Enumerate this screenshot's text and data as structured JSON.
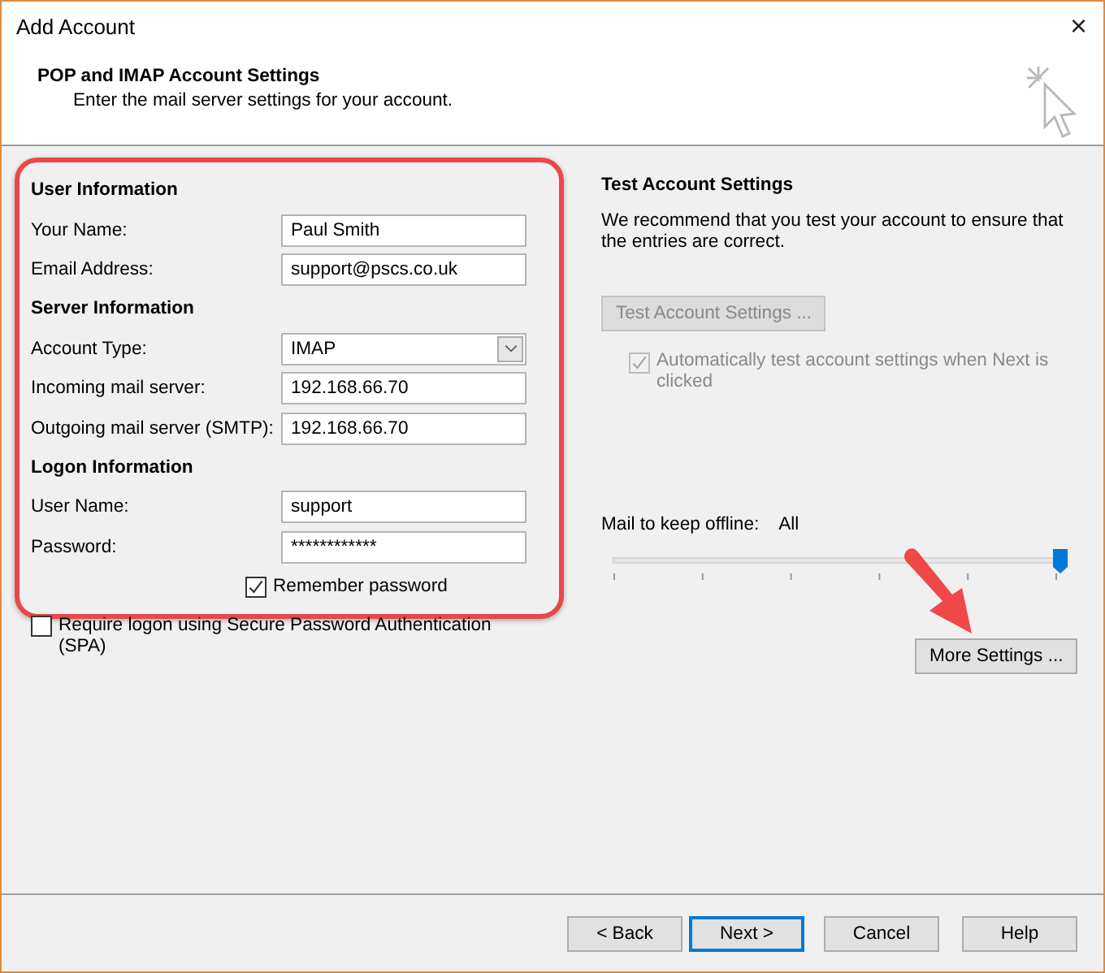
{
  "window": {
    "title": "Add Account",
    "close": "×"
  },
  "header": {
    "title": "POP and IMAP Account Settings",
    "subtitle": "Enter the mail server settings for your account."
  },
  "left": [
    {
      "kind": "heading",
      "label": "User Information"
    },
    {
      "kind": "text",
      "label": "Your Name:",
      "value": "Paul Smith"
    },
    {
      "kind": "text",
      "label": "Email Address:",
      "value": "support@pscs.co.uk"
    },
    {
      "kind": "heading",
      "label": "Server Information"
    },
    {
      "kind": "select",
      "label": "Account Type:",
      "value": "IMAP"
    },
    {
      "kind": "text",
      "label": "Incoming mail server:",
      "value": "192.168.66.70"
    },
    {
      "kind": "text",
      "label": "Outgoing mail server (SMTP):",
      "value": "192.168.66.70"
    },
    {
      "kind": "heading",
      "label": "Logon Information"
    },
    {
      "kind": "text",
      "label": "User Name:",
      "value": "support"
    },
    {
      "kind": "text",
      "label": "Password:",
      "value": "************"
    },
    {
      "kind": "checkbox",
      "label": "Remember password",
      "checked": true
    }
  ],
  "spa": {
    "label": "Require logon using Secure Password Authentication (SPA)",
    "checked": false
  },
  "test": {
    "title": "Test Account Settings",
    "text": "We recommend that you test your account to ensure that the entries are correct.",
    "button": "Test Account Settings ...",
    "button_disabled": true,
    "auto": {
      "label": "Automatically test account settings when Next is clicked",
      "checked": true,
      "disabled": true
    }
  },
  "offline": {
    "label": "Mail to keep offline:",
    "value": "All",
    "level": 1
  },
  "more_button": "More Settings ...",
  "footer": [
    {
      "label": "< Back",
      "selected": false
    },
    {
      "label": "Next >",
      "selected": true
    },
    {
      "label": "Cancel",
      "selected": false
    },
    {
      "label": "Help",
      "selected": false
    }
  ]
}
